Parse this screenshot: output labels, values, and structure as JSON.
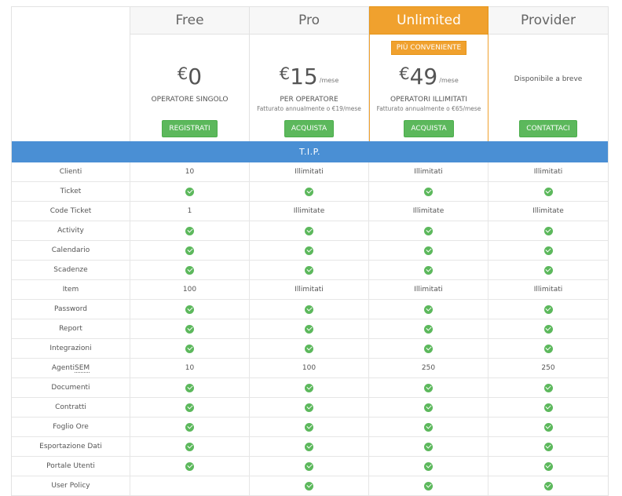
{
  "plans": [
    {
      "name": "Free",
      "currency": "€",
      "amount": "0",
      "per": "",
      "desc": "OPERATORE SINGOLO",
      "sub": "",
      "badge": "",
      "button": "REGISTRATI",
      "featured": false
    },
    {
      "name": "Pro",
      "currency": "€",
      "amount": "15",
      "per": "/mese",
      "desc": "PER OPERATORE",
      "sub": "Fatturato annualmente o €19/mese",
      "badge": "",
      "button": "ACQUISTA",
      "featured": false
    },
    {
      "name": "Unlimited",
      "currency": "€",
      "amount": "49",
      "per": "/mese",
      "desc": "OPERATORI ILLIMITATI",
      "sub": "Fatturato annualmente o €65/mese",
      "badge": "PIÙ CONVENIENTE",
      "button": "ACQUISTA",
      "featured": true
    },
    {
      "name": "Provider",
      "currency": "",
      "amount": "",
      "per": "",
      "desc": "",
      "sub": "",
      "soon": "Disponibile a breve",
      "badge": "",
      "button": "CONTATTACI",
      "featured": false
    }
  ],
  "section_title": "T.I.P.",
  "features": [
    {
      "label": "Clienti",
      "values": [
        "10",
        "Illimitati",
        "Illimitati",
        "Illimitati"
      ]
    },
    {
      "label": "Ticket",
      "values": [
        "check",
        "check",
        "check",
        "check"
      ]
    },
    {
      "label": "Code Ticket",
      "values": [
        "1",
        "Illimitate",
        "Illimitate",
        "Illimitate"
      ]
    },
    {
      "label": "Activity",
      "values": [
        "check",
        "check",
        "check",
        "check"
      ]
    },
    {
      "label": "Calendario",
      "values": [
        "check",
        "check",
        "check",
        "check"
      ]
    },
    {
      "label": "Scadenze",
      "values": [
        "check",
        "check",
        "check",
        "check"
      ]
    },
    {
      "label": "Item",
      "values": [
        "100",
        "Illimitati",
        "Illimitati",
        "Illimitati"
      ]
    },
    {
      "label": "Password",
      "values": [
        "check",
        "check",
        "check",
        "check"
      ]
    },
    {
      "label": "Report",
      "values": [
        "check",
        "check",
        "check",
        "check"
      ]
    },
    {
      "label": "Integrazioni",
      "values": [
        "check",
        "check",
        "check",
        "check"
      ]
    },
    {
      "label": "Agenti SEM",
      "label_pre": "Agenti ",
      "label_abbr": "SEM",
      "values": [
        "10",
        "100",
        "250",
        "250"
      ]
    },
    {
      "label": "Documenti",
      "values": [
        "check",
        "check",
        "check",
        "check"
      ]
    },
    {
      "label": "Contratti",
      "values": [
        "check",
        "check",
        "check",
        "check"
      ]
    },
    {
      "label": "Foglio Ore",
      "values": [
        "check",
        "check",
        "check",
        "check"
      ]
    },
    {
      "label": "Esportazione Dati",
      "values": [
        "check",
        "check",
        "check",
        "check"
      ]
    },
    {
      "label": "Portale Utenti",
      "values": [
        "check",
        "check",
        "check",
        "check"
      ]
    },
    {
      "label": "User Policy",
      "values": [
        "",
        "check",
        "check",
        "check"
      ]
    }
  ],
  "colors": {
    "accent": "#f0a12e",
    "section": "#4a8fd4",
    "button": "#5cb85c",
    "check": "#5cb85c"
  },
  "icons": {
    "check": "check-circle-icon"
  }
}
